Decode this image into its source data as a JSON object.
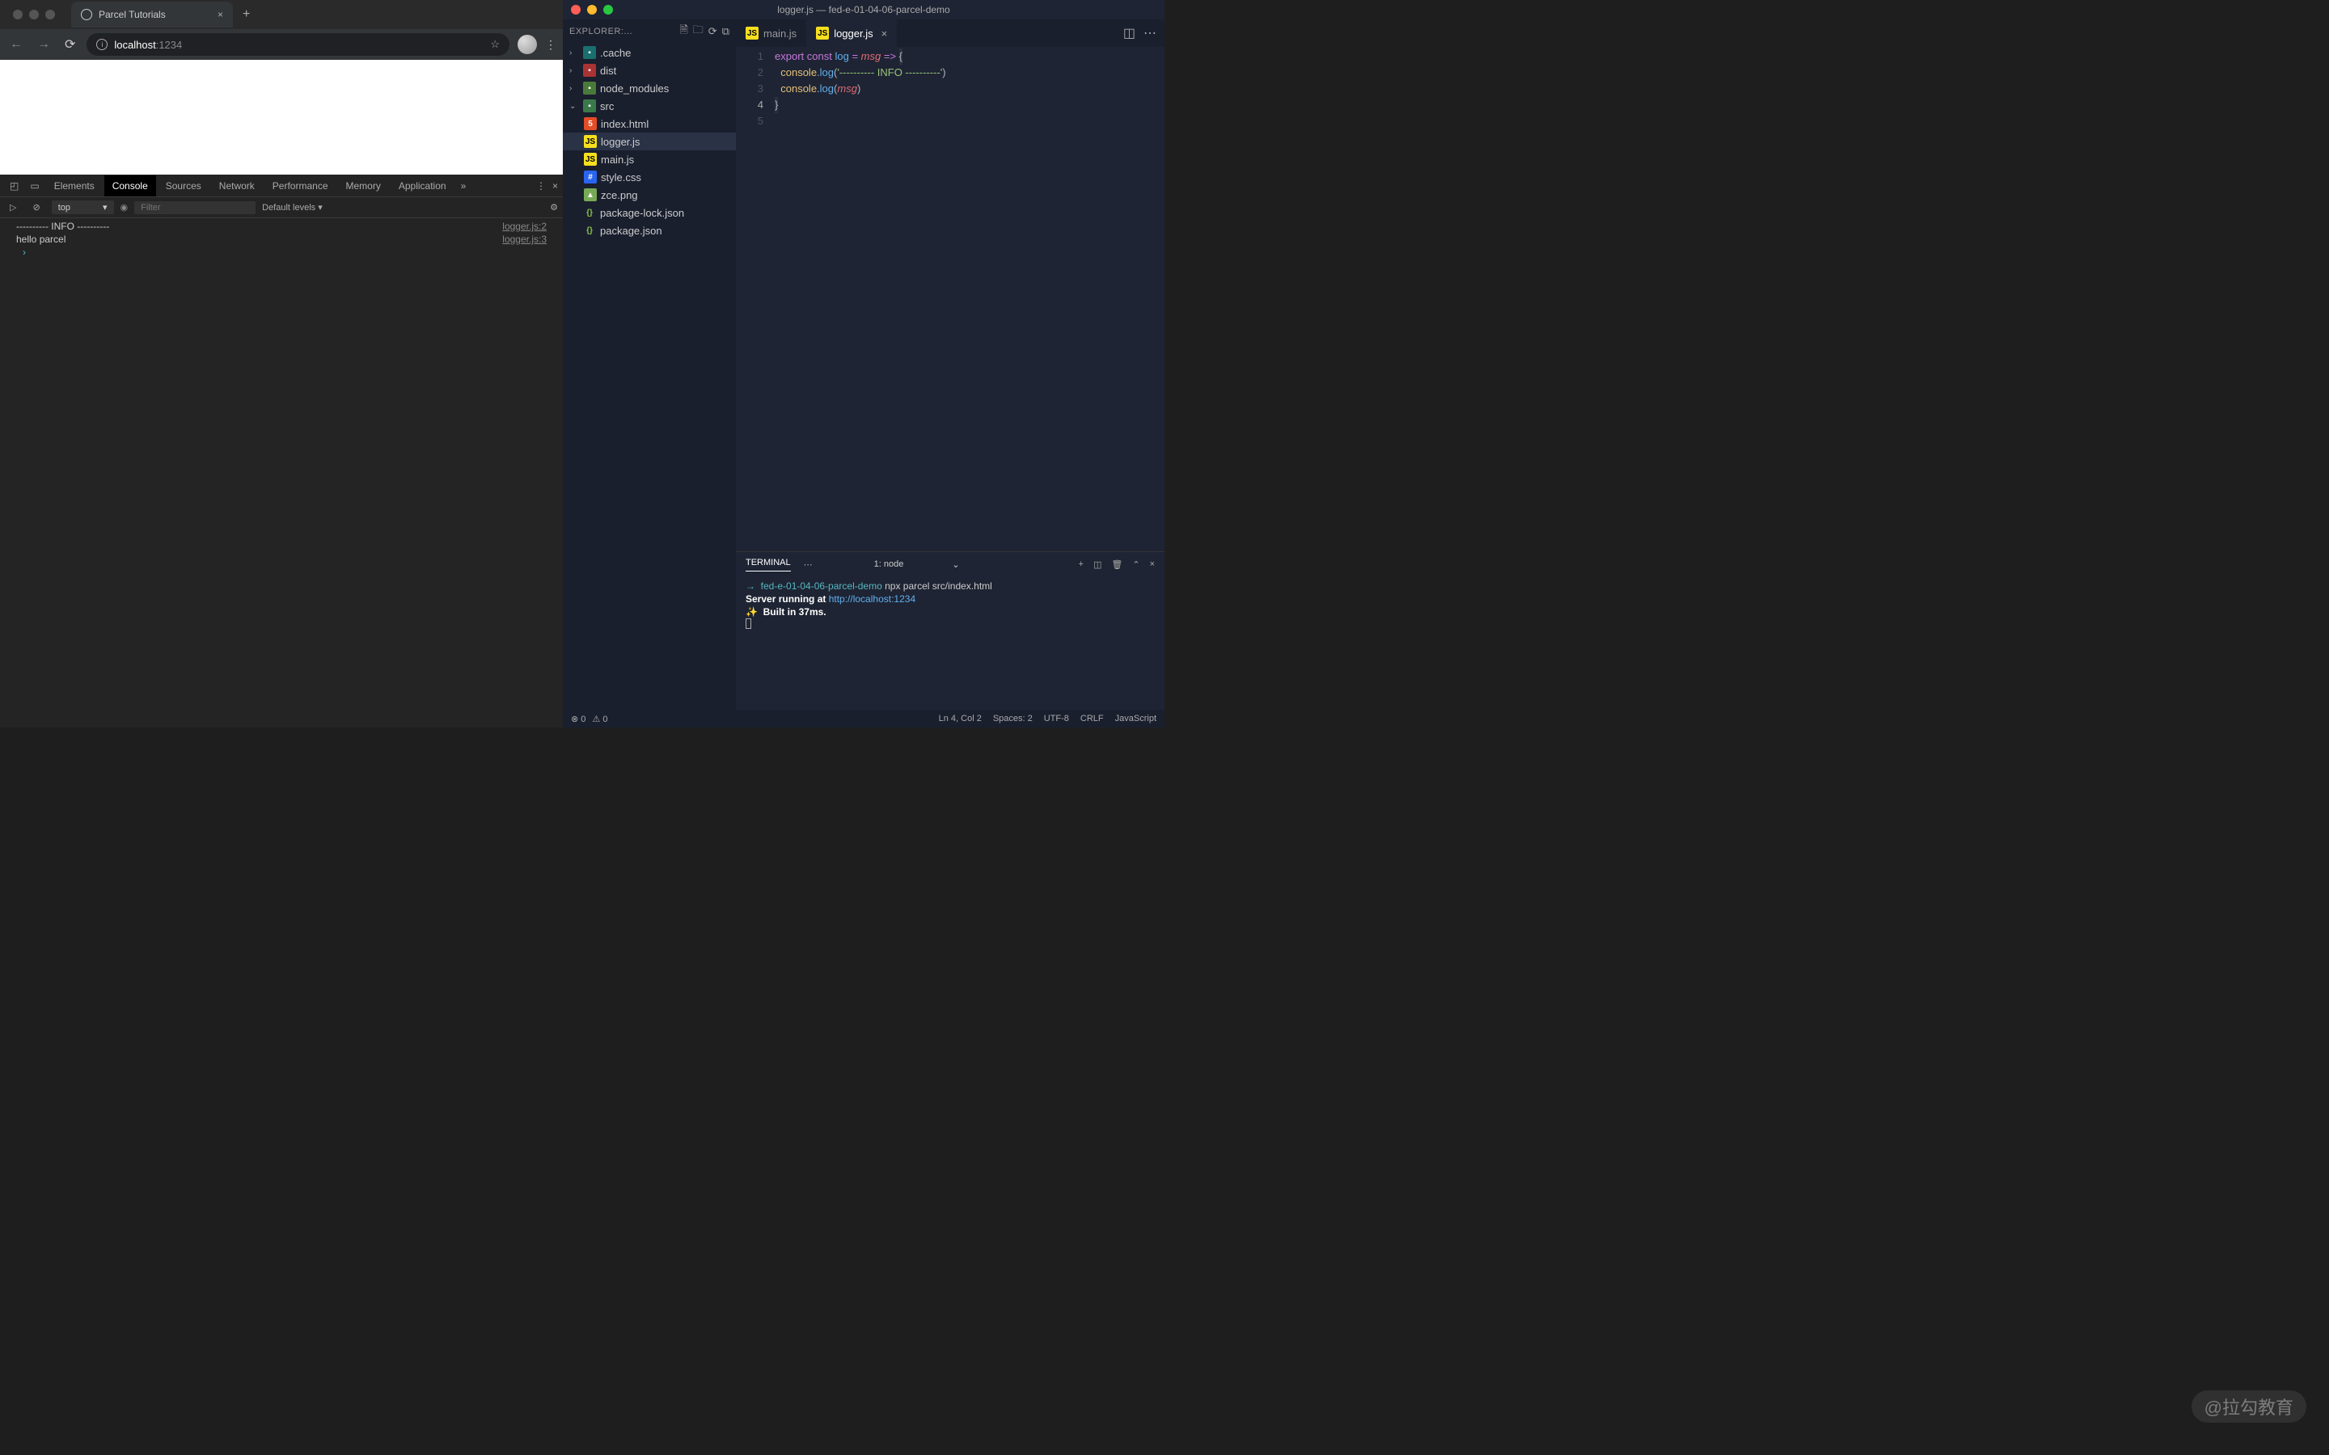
{
  "browser": {
    "tab_title": "Parcel Tutorials",
    "url_host": "localhost",
    "url_port": ":1234"
  },
  "devtools": {
    "tabs": [
      "Elements",
      "Console",
      "Sources",
      "Network",
      "Performance",
      "Memory",
      "Application"
    ],
    "active_tab": "Console",
    "context": "top",
    "filter_placeholder": "Filter",
    "levels": "Default levels",
    "logs": [
      {
        "msg": "---------- INFO ----------",
        "src": "logger.js:2"
      },
      {
        "msg": "hello parcel",
        "src": "logger.js:3"
      }
    ]
  },
  "vscode": {
    "title": "logger.js — fed-e-01-04-06-parcel-demo",
    "explorer_label": "EXPLORER:...",
    "tree": {
      "folders": [
        {
          "name": ".cache",
          "icon": "folder-cache",
          "expanded": false
        },
        {
          "name": "dist",
          "icon": "folder-dist",
          "expanded": false
        },
        {
          "name": "node_modules",
          "icon": "folder-node",
          "expanded": false
        },
        {
          "name": "src",
          "icon": "folder-src",
          "expanded": true
        }
      ],
      "src_files": [
        {
          "name": "index.html",
          "icon": "html5"
        },
        {
          "name": "logger.js",
          "icon": "js"
        },
        {
          "name": "main.js",
          "icon": "js"
        },
        {
          "name": "style.css",
          "icon": "css"
        },
        {
          "name": "zce.png",
          "icon": "img"
        }
      ],
      "root_files": [
        {
          "name": "package-lock.json",
          "icon": "json"
        },
        {
          "name": "package.json",
          "icon": "json"
        }
      ]
    },
    "tabs": [
      {
        "name": "main.js",
        "icon": "js",
        "active": false
      },
      {
        "name": "logger.js",
        "icon": "js",
        "active": true
      }
    ],
    "code": {
      "lines": [
        {
          "n": 1,
          "html": "<span class='tok-kw'>export</span> <span class='tok-kw2'>const</span> <span class='tok-fn'>log</span> <span class='tok-op'>=</span> <span class='tok-var'>msg</span> <span class='tok-op'>=&gt;</span> <span class='tok-pun hl'>{</span>"
        },
        {
          "n": 2,
          "html": "  <span class='tok-obj'>console</span><span class='tok-pun'>.</span><span class='tok-fn'>log</span><span class='tok-pun'>(</span><span class='tok-str'>'---------- INFO ----------'</span><span class='tok-pun'>)</span>"
        },
        {
          "n": 3,
          "html": "  <span class='tok-obj'>console</span><span class='tok-pun'>.</span><span class='tok-fn'>log</span><span class='tok-pun'>(</span><span class='tok-var'>msg</span><span class='tok-pun'>)</span>"
        },
        {
          "n": 4,
          "html": "<span class='tok-pun hl'>}</span>",
          "cur": true
        },
        {
          "n": 5,
          "html": ""
        }
      ]
    },
    "terminal": {
      "tab": "TERMINAL",
      "shell": "1: node",
      "prompt_arrow": "→",
      "cwd": "fed-e-01-04-06-parcel-demo",
      "command": "npx parcel src/index.html",
      "line2_a": "Server running at ",
      "line2_b": "http://localhost:1234",
      "line3": "Built in 37ms."
    },
    "status": {
      "errors": "0",
      "warnings": "0",
      "pos": "Ln 4, Col 2",
      "spaces": "Spaces: 2",
      "enc": "UTF-8",
      "eol": "CRLF",
      "lang": "JavaScript"
    }
  },
  "watermark": "@拉勾教育"
}
